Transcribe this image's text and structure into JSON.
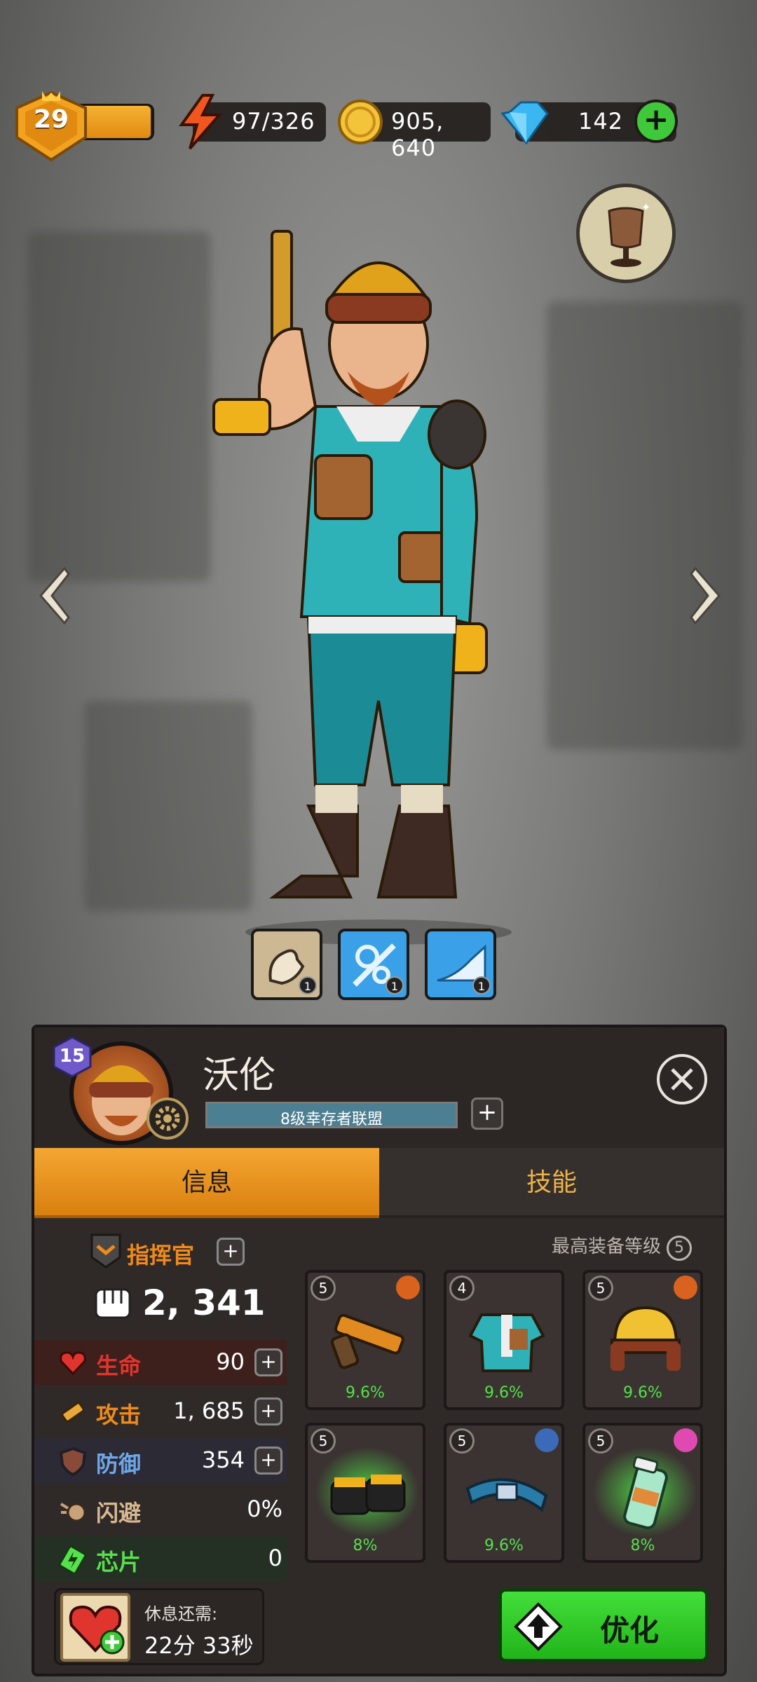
{
  "top_bar": {
    "player_level": "29",
    "level_progress": 0.98,
    "energy": "97/326",
    "gold": "905, 640",
    "gems": "142",
    "add_gems_icon": "plus-icon"
  },
  "skills": [
    {
      "icon": "flexed-arm-icon",
      "count": "1"
    },
    {
      "icon": "gears-wrench-icon",
      "count": "1"
    },
    {
      "icon": "horn-icon",
      "count": "1"
    }
  ],
  "hero": {
    "level": "15",
    "name": "沃伦",
    "alliance": "8级幸存者联盟"
  },
  "tabs": {
    "info": "信息",
    "skills": "技能"
  },
  "stats": {
    "commander_label": "指挥官",
    "power": "2, 341",
    "hp_label": "生命",
    "hp": "90",
    "attack_label": "攻击",
    "attack": "1, 685",
    "defense_label": "防御",
    "defense": "354",
    "dodge_label": "闪避",
    "dodge": "0%",
    "chip_label": "芯片",
    "chip": "0"
  },
  "equipment": {
    "max_label": "最高装备等级",
    "max_level": "5",
    "slots": [
      {
        "level": "5",
        "bonus": "9.6%",
        "item": "pistol"
      },
      {
        "level": "4",
        "bonus": "9.6%",
        "item": "jacket"
      },
      {
        "level": "5",
        "bonus": "9.6%",
        "item": "helmet"
      },
      {
        "level": "5",
        "bonus": "8%",
        "item": "gloves"
      },
      {
        "level": "5",
        "bonus": "9.6%",
        "item": "belt"
      },
      {
        "level": "5",
        "bonus": "8%",
        "item": "potion-bottle"
      }
    ]
  },
  "rest": {
    "label": "休息还需:",
    "time": "22分 33秒"
  },
  "optimize_label": "优化",
  "colors": {
    "accent_orange": "#f08a1b",
    "green_button": "#3fc93a",
    "hp_red": "#e0352e",
    "attack_orange": "#f08a1b",
    "defense_blue": "#6ea8e8",
    "dodge_tan": "#d8b892",
    "chip_green": "#57e04d"
  }
}
